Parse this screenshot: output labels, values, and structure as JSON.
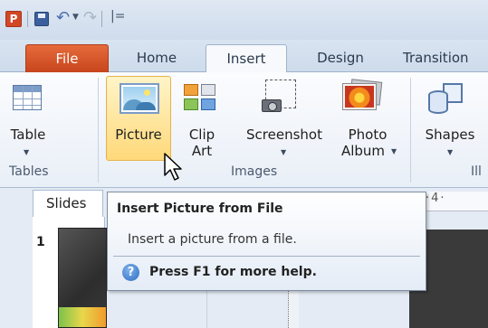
{
  "tabs": [
    {
      "label": "File"
    },
    {
      "label": "Home"
    },
    {
      "label": "Insert"
    },
    {
      "label": "Design"
    },
    {
      "label": "Transition"
    }
  ],
  "ribbon": {
    "table_label": "Table",
    "tables_group": "Tables",
    "picture_label": "Picture",
    "clip_label_1": "Clip",
    "clip_label_2": "Art",
    "screenshot_label": "Screenshot",
    "photo_label_1": "Photo",
    "photo_label_2": "Album",
    "images_group": "Images",
    "shapes_label": "Shapes",
    "illus_group": "Ill"
  },
  "slides_pane": {
    "tab_label": "Slides",
    "slide_number": "1",
    "ruler_text": "·4·"
  },
  "tooltip": {
    "title": "Insert Picture from File",
    "description": "Insert a picture from a file.",
    "help_text": "Press F1 for more help.",
    "help_icon": "?"
  },
  "qat": {
    "app_letter": "P",
    "customize_glyph": "|="
  },
  "colors": {
    "file_tab": "#d04a21",
    "picture_highlight": "#ffd97a",
    "ribbon_border": "#9fb3cd"
  }
}
